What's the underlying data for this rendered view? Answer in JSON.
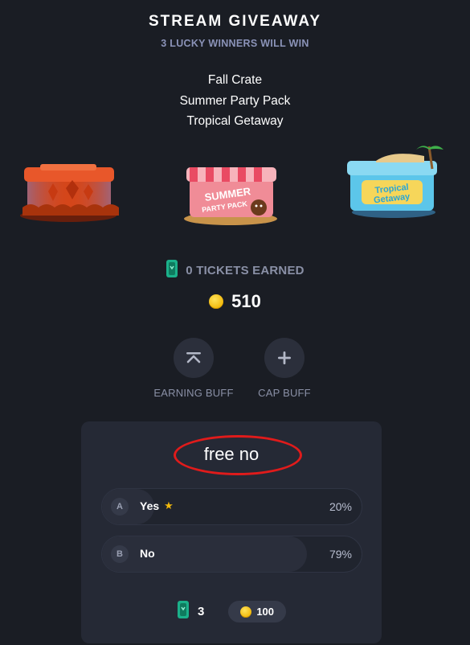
{
  "header": {
    "title": "STREAM GIVEAWAY",
    "subtitle": "3 LUCKY WINNERS WILL WIN"
  },
  "prizes": [
    "Fall Crate",
    "Summer Party Pack",
    "Tropical Getaway"
  ],
  "stats": {
    "tickets_text": "0 TICKETS EARNED",
    "coins": "510"
  },
  "buffs": {
    "earning_label": "EARNING BUFF",
    "cap_label": "CAP BUFF"
  },
  "poll": {
    "question": "free no",
    "options": [
      {
        "letter": "A",
        "label": "Yes",
        "percent": "20%",
        "fill": 0.2
      },
      {
        "letter": "B",
        "label": "No",
        "percent": "79%",
        "fill": 0.79
      }
    ],
    "tickets_count": "3",
    "cost": "100"
  },
  "colors": {
    "background": "#1a1d24",
    "panel": "#252935",
    "accent_gold": "#f2b90c",
    "ticket_green": "#1bb08a",
    "highlight_red": "#e01b1b"
  },
  "icons": {
    "ticket": "ticket-icon",
    "coin": "coin-icon",
    "earning_buff": "chevron-up-bar-icon",
    "cap_buff": "plus-icon",
    "star": "star-icon"
  }
}
